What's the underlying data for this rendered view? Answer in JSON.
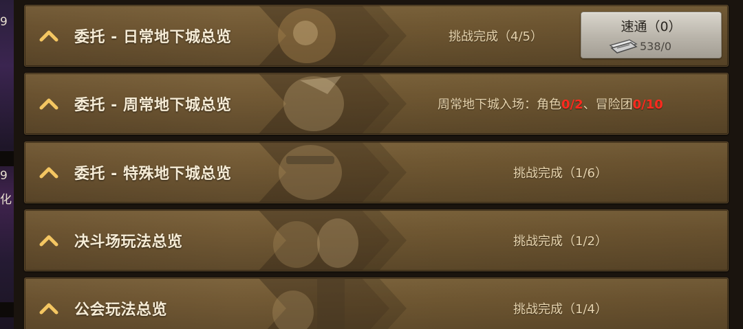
{
  "left_strip": {
    "badge_1": "9",
    "badge_2": "9",
    "badge_3": "化"
  },
  "rows": [
    {
      "title": "委托 - 日常地下城总览",
      "status": "挑战完成（4/5）",
      "speed_button": {
        "label": "速通（0）",
        "count": "538/0",
        "icon": "ticket-icon"
      }
    },
    {
      "title": "委托 - 周常地下城总览",
      "status_prefix": "周常地下城入场：角色",
      "status_char_value": "0/2",
      "status_mid": "、冒险团",
      "status_team_value": "0/10",
      "highlight_color": "#ff2a1e"
    },
    {
      "title": "委托 - 特殊地下城总览",
      "status": "挑战完成（1/6）"
    },
    {
      "title": "决斗场玩法总览",
      "status": "挑战完成（1/2）"
    },
    {
      "title": "公会玩法总览",
      "status": "挑战完成（1/4）"
    }
  ],
  "icons": {
    "expand": "chevron-up-icon"
  }
}
